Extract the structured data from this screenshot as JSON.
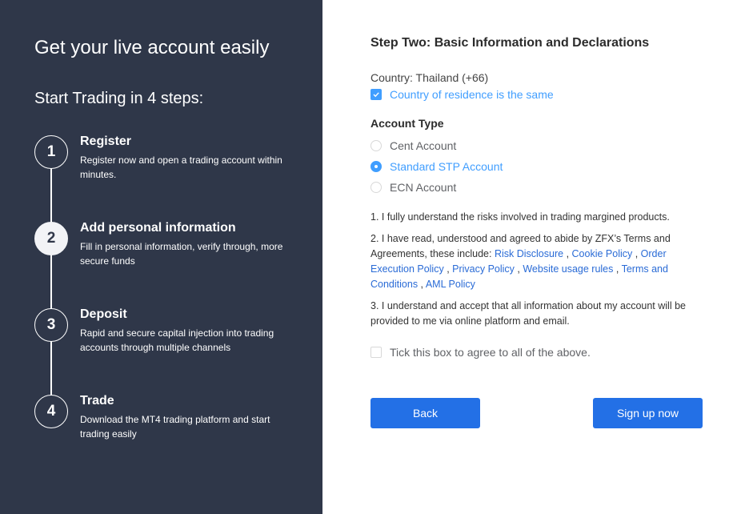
{
  "left_panel": {
    "title": "Get your live account easily",
    "subtitle": "Start Trading in 4 steps:",
    "steps": [
      {
        "number": "1",
        "title": "Register",
        "description": "Register now and open a trading account within minutes.",
        "active": false
      },
      {
        "number": "2",
        "title": "Add personal information",
        "description": "Fill in personal information, verify through, more secure funds",
        "active": true
      },
      {
        "number": "3",
        "title": "Deposit",
        "description": "Rapid and secure capital injection into trading accounts through multiple channels",
        "active": false
      },
      {
        "number": "4",
        "title": "Trade",
        "description": "Download the MT4 trading platform and start trading easily",
        "active": false
      }
    ]
  },
  "form": {
    "title": "Step Two: Basic Information and Declarations",
    "country_text": "Country: Thailand (+66)",
    "residence_checkbox": {
      "label": "Country of residence is the same",
      "checked": true
    },
    "account_type_label": "Account Type",
    "account_types": [
      {
        "label": "Cent Account",
        "selected": false
      },
      {
        "label": "Standard STP Account",
        "selected": true
      },
      {
        "label": "ECN Account",
        "selected": false
      }
    ],
    "declarations": {
      "d1": "1. I fully understand the risks involved in trading margined products.",
      "d2_prefix": "2. I have read, understood and agreed to abide by ZFX’s Terms and Agreements, these include: ",
      "d2_links": [
        "Risk Disclosure",
        "Cookie Policy",
        "Order Execution Policy",
        "Privacy Policy",
        "Website usage rules",
        "Terms and Conditions",
        "AML Policy"
      ],
      "separator": " , ",
      "d3": "3. I understand and accept that all information about my account will be provided to me via online platform and email."
    },
    "agree_checkbox": {
      "label": "Tick this box to agree to all of the above.",
      "checked": false
    },
    "buttons": {
      "back": "Back",
      "signup": "Sign up now"
    }
  },
  "colors": {
    "sidebar_bg": "#2f3749",
    "accent_blue": "#409eff",
    "link_blue": "#2a6bd6",
    "button_blue": "#2370e6"
  }
}
